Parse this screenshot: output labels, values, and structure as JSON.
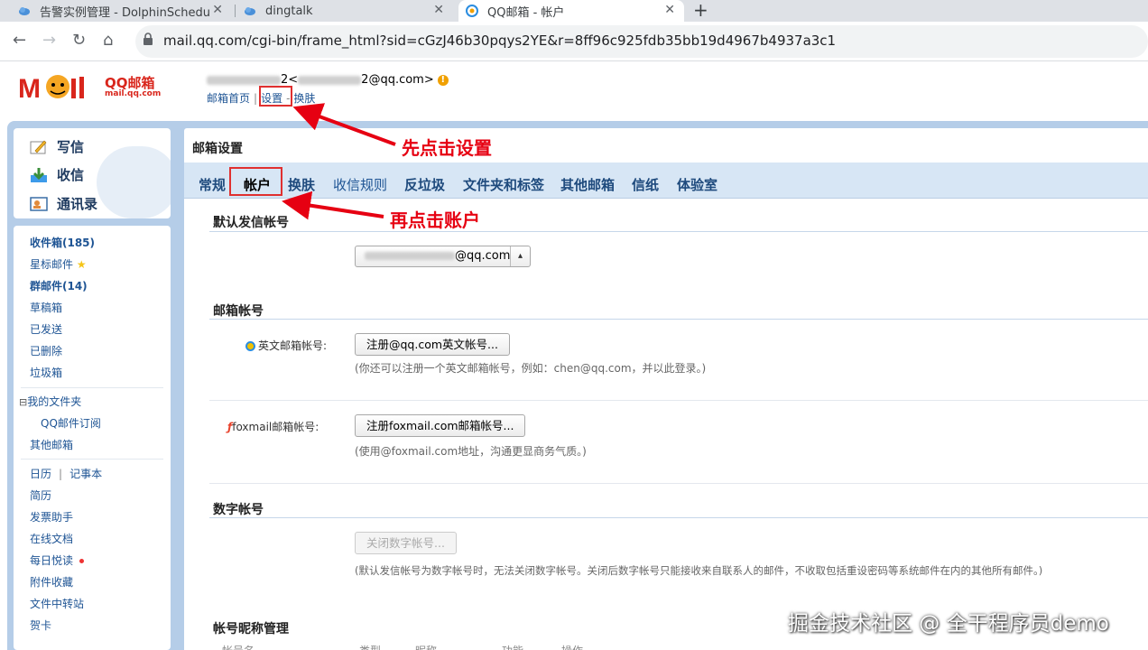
{
  "browser": {
    "tabs": [
      {
        "title": "告警实例管理 - DolphinSchedu"
      },
      {
        "title": "dingtalk"
      },
      {
        "title": "QQ邮箱 - 帐户"
      }
    ],
    "url": "mail.qq.com/cgi-bin/frame_html?sid=cGzJ46b30pqys2YE&r=8ff96c925fdb35bb19d4967b4937a3c1"
  },
  "header": {
    "logo_brand": "QQ邮箱",
    "logo_domain": "mail.qq.com",
    "user_lt": "2<",
    "user_email_suffix": "2@qq.com>",
    "links": [
      "邮箱首页",
      "设置",
      "换肤"
    ]
  },
  "annotations": {
    "step1": "先点击设置",
    "step2": "再点击账户"
  },
  "left_top": {
    "compose": "写信",
    "inbox": "收信",
    "contacts": "通讯录"
  },
  "left_nav": {
    "inbox": "收件箱(185)",
    "starred": "星标邮件",
    "group": "群邮件(14)",
    "drafts": "草稿箱",
    "sent": "已发送",
    "deleted": "已删除",
    "spam": "垃圾箱",
    "my_folders": "我的文件夹",
    "subscription": "QQ邮件订阅",
    "other_mailbox": "其他邮箱",
    "calendar": "日历",
    "divider": "|",
    "notes": "记事本",
    "resume": "简历",
    "invoice": "发票助手",
    "docs": "在线文档",
    "daily": "每日悦读",
    "attachments": "附件收藏",
    "transfer": "文件中转站",
    "cards": "贺卡"
  },
  "main": {
    "title": "邮箱设置",
    "tabs": [
      "常规",
      "帐户",
      "换肤",
      "收信规则",
      "反垃圾",
      "文件夹和标签",
      "其他邮箱",
      "信纸",
      "体验室"
    ],
    "default_sender_title": "默认发信帐号",
    "default_sender_value": "@qq.com",
    "mailbox_account_title": "邮箱帐号",
    "english_label": "英文邮箱帐号:",
    "english_button": "注册@qq.com英文帐号...",
    "english_hint": "(你还可以注册一个英文邮箱帐号，例如：chen@qq.com，并以此登录。)",
    "foxmail_label": "foxmail邮箱帐号:",
    "foxmail_button": "注册foxmail.com邮箱帐号...",
    "foxmail_hint": "(使用@foxmail.com地址，沟通更显商务气质。)",
    "digital_title": "数字帐号",
    "digital_button": "关闭数字帐号...",
    "digital_hint": "(默认发信帐号为数字帐号时，无法关闭数字帐号。关闭后数字帐号只能接收来自联系人的邮件，不收取包括重设密码等系统邮件在内的其他所有邮件。)",
    "nickname_title": "帐号昵称管理",
    "nickname_columns": [
      "帐号名",
      "类型",
      "昵称",
      "功能",
      "操作"
    ]
  },
  "watermark": "掘金技术社区 @ 全干程序员demo"
}
